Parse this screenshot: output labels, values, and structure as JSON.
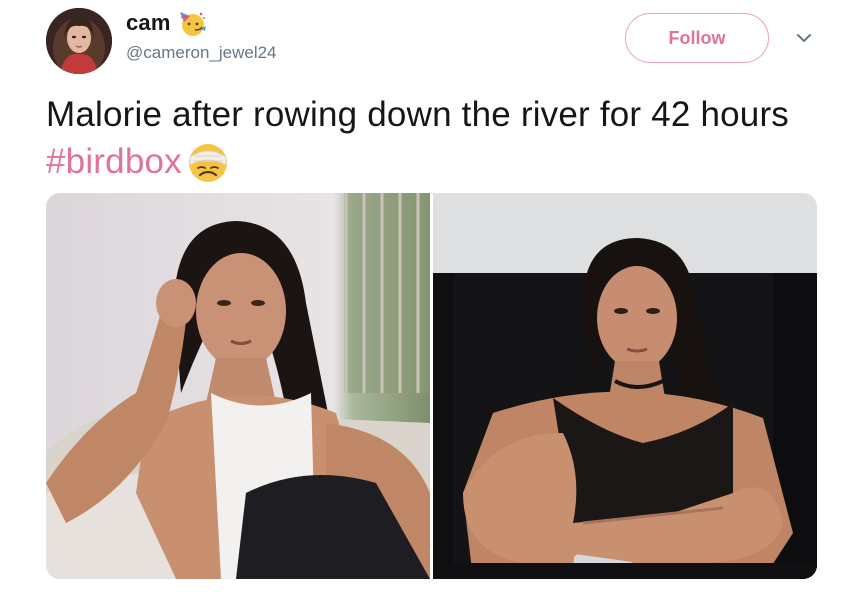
{
  "tweet": {
    "display_name": "cam",
    "handle": "@cameron_jewel24",
    "follow_label": "Follow",
    "text_main": "Malorie after rowing down the river for 42 hours ",
    "hashtag": "#birdbox",
    "name_emoji": "party-face-emoji",
    "text_emoji": "bandaged-face-emoji"
  },
  "media": {
    "images": [
      {
        "name": "photo-left",
        "description_icon": "photo"
      },
      {
        "name": "photo-right",
        "description_icon": "photo"
      }
    ]
  },
  "colors": {
    "accent": "#e0729c",
    "follow_border": "#e8a3bd",
    "text": "#14171a",
    "secondary_text": "#657786"
  }
}
